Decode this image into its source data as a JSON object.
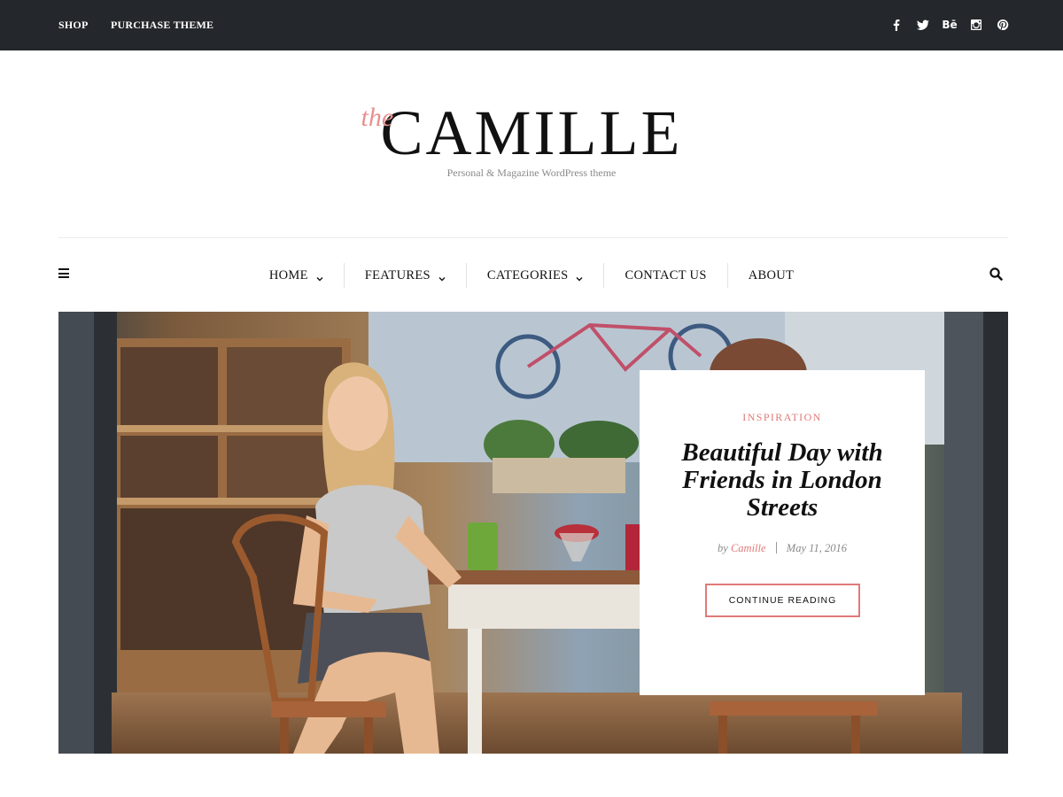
{
  "colors": {
    "topbar": "#24272b",
    "accent": "#e07a78",
    "logo_the": "#e8908e"
  },
  "topbar": {
    "links": [
      "SHOP",
      "PURCHASE THEME"
    ],
    "social_icons": [
      "facebook-icon",
      "twitter-icon",
      "behance-icon",
      "instagram-icon",
      "pinterest-icon"
    ],
    "behance_text": "Bē"
  },
  "logo": {
    "the": "the",
    "main": "CAMILLE",
    "tagline": "Personal & Magazine WordPress theme"
  },
  "nav": {
    "items": [
      {
        "label": "HOME",
        "has_dropdown": true
      },
      {
        "label": "FEATURES",
        "has_dropdown": true
      },
      {
        "label": "CATEGORIES",
        "has_dropdown": true
      },
      {
        "label": "CONTACT US",
        "has_dropdown": false
      },
      {
        "label": "ABOUT",
        "has_dropdown": false
      }
    ]
  },
  "featured": {
    "category": "INSPIRATION",
    "title": "Beautiful Day with Friends in London Streets",
    "by": "by",
    "author": "Camille",
    "date": "May 11, 2016",
    "button": "CONTINUE READING"
  }
}
